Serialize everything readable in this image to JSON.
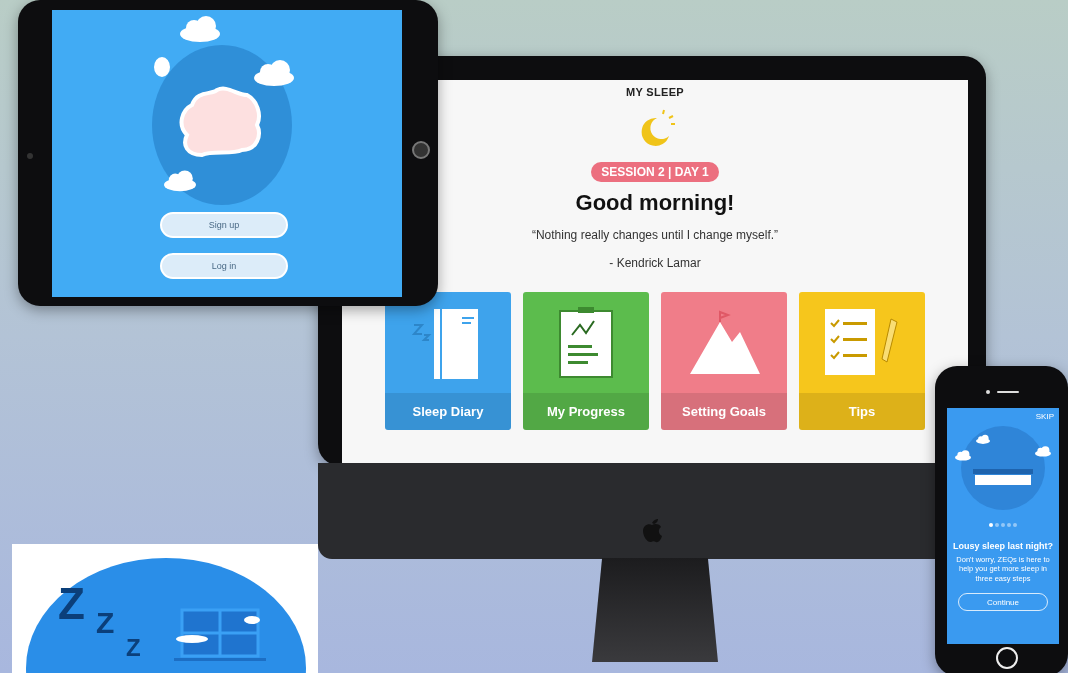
{
  "tablet": {
    "buttons": [
      {
        "label": "Sign up"
      },
      {
        "label": "Log in"
      }
    ]
  },
  "desktop": {
    "title": "MY SLEEP",
    "badge": "SESSION 2 | DAY 1",
    "greeting": "Good morning!",
    "quote": "“Nothing really changes until I change myself.”",
    "author": "- Kendrick Lamar",
    "cards": [
      {
        "label": "Sleep Diary",
        "kind": "diary",
        "color": "#3ea3ec"
      },
      {
        "label": "My Progress",
        "kind": "progress",
        "color": "#5cbc4d"
      },
      {
        "label": "Setting Goals",
        "kind": "goals",
        "color": "#f07d89"
      },
      {
        "label": "Tips",
        "kind": "tips",
        "color": "#f6c61c"
      }
    ]
  },
  "phone": {
    "skip": "SKIP",
    "pages": [
      {
        "selected": true
      },
      {
        "selected": false
      },
      {
        "selected": false
      },
      {
        "selected": false
      },
      {
        "selected": false
      }
    ],
    "headline": "Lousy sleep last night?",
    "body": "Don't worry, ZEQs is here to help you get more sleep in three easy steps",
    "button": "Continue"
  },
  "illustration": {
    "letters": [
      "Z",
      "Z",
      "Z"
    ]
  }
}
